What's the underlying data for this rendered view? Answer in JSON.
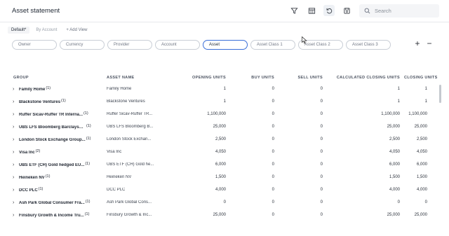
{
  "header": {
    "title": "Asset statement",
    "search_placeholder": "Search",
    "icons": [
      "filter-icon",
      "columns-icon",
      "refresh-icon",
      "save-icon",
      "search-icon"
    ]
  },
  "views": {
    "tabs": [
      {
        "label": "Default*",
        "active": true
      },
      {
        "label": "By Account",
        "active": false
      }
    ],
    "add_label": "+ Add View"
  },
  "groupings": {
    "chips": [
      "Owner",
      "Currency",
      "Provider",
      "Account",
      "Asset",
      "Asset Class 1",
      "Asset Class 2",
      "Asset Class 3"
    ],
    "active": "Asset",
    "add_symbol": "+",
    "remove_symbol": "−"
  },
  "table": {
    "columns": [
      "GROUP",
      "ASSET NAME",
      "OPENING UNITS",
      "BUY UNITS",
      "SELL UNITS",
      "CALCULATED CLOSING UNITS",
      "CLOSING UNITS"
    ],
    "rows": [
      {
        "group": "Family Home",
        "count": "(1)",
        "asset": "Family Home",
        "opening": "1",
        "buy": "0",
        "sell": "0",
        "calc_closing": "1",
        "closing": "1"
      },
      {
        "group": "Blackstone Ventures",
        "count": "(1)",
        "asset": "Blackstone Ventures",
        "opening": "1",
        "buy": "0",
        "sell": "0",
        "calc_closing": "1",
        "closing": "1"
      },
      {
        "group": "Ruffer Sicav-Ruffer TR Interna...",
        "count": "(1)",
        "asset": "Ruffer Sicav-Ruffer TR...",
        "opening": "1,100,000",
        "buy": "0",
        "sell": "0",
        "calc_closing": "1,100,000",
        "closing": "1,100,000"
      },
      {
        "group": "UBS LFS Bloomberg BarclaysTi...",
        "count": "(1)",
        "asset": "UBS LFS Bloomberg B...",
        "opening": "25,000",
        "buy": "0",
        "sell": "0",
        "calc_closing": "25,000",
        "closing": "25,000"
      },
      {
        "group": "London Stock Exchange Group...",
        "count": "(1)",
        "asset": "London Stock Exchan...",
        "opening": "2,500",
        "buy": "0",
        "sell": "0",
        "calc_closing": "2,500",
        "closing": "2,500"
      },
      {
        "group": "Visa Inc",
        "count": "(2)",
        "asset": "Visa Inc",
        "opening": "4,050",
        "buy": "0",
        "sell": "0",
        "calc_closing": "4,050",
        "closing": "4,050"
      },
      {
        "group": "UBS ETF (CH) Gold hedged EU...",
        "count": "(1)",
        "asset": "UBS ETF (CH) Gold he...",
        "opening": "6,000",
        "buy": "0",
        "sell": "0",
        "calc_closing": "6,000",
        "closing": "6,000"
      },
      {
        "group": "Heineken NV",
        "count": "(1)",
        "asset": "Heineken NV",
        "opening": "1,500",
        "buy": "0",
        "sell": "0",
        "calc_closing": "1,500",
        "closing": "1,500"
      },
      {
        "group": "DCC PLC",
        "count": "(1)",
        "asset": "DCC PLC",
        "opening": "4,000",
        "buy": "0",
        "sell": "0",
        "calc_closing": "4,000",
        "closing": "4,000"
      },
      {
        "group": "Ash Park Global Consumer Fra...",
        "count": "(1)",
        "asset": "Ash Park Global Cons...",
        "opening": "0",
        "buy": "0",
        "sell": "0",
        "calc_closing": "0",
        "closing": "0"
      },
      {
        "group": "Finsbury Growth & Income Tru...",
        "count": "(1)",
        "asset": "Finsbury Growth & Inc...",
        "opening": "25,000",
        "buy": "0",
        "sell": "0",
        "calc_closing": "25,000",
        "closing": "25,000"
      }
    ]
  },
  "colors": {
    "accent": "#3b6fd8",
    "border": "#c9ced6",
    "text": "#1f2733"
  }
}
